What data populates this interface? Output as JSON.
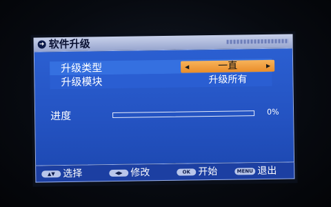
{
  "window": {
    "title": "软件升级",
    "icon": "back-icon"
  },
  "menu": {
    "rows": [
      {
        "label": "升级类型",
        "value": "一直",
        "has_arrows": true
      },
      {
        "label": "升级模块",
        "value": "升级所有"
      }
    ],
    "progress": {
      "label": "进度",
      "value_text": "0%",
      "percent": 0
    }
  },
  "footer": {
    "keys": [
      {
        "badge": "▲▼",
        "label": "选择",
        "icon": "up-down-icon"
      },
      {
        "badge": "◀▶",
        "label": "修改",
        "icon": "left-right-icon"
      },
      {
        "badge": "OK",
        "label": "开始",
        "icon": "ok-key-icon"
      },
      {
        "badge": "MENU",
        "label": "退出",
        "icon": "menu-key-icon"
      }
    ]
  },
  "colors": {
    "panel": "#2453c2",
    "highlight": "#3570e0",
    "selector": "#ea8d2a",
    "titlebar": "#98a6cf"
  }
}
